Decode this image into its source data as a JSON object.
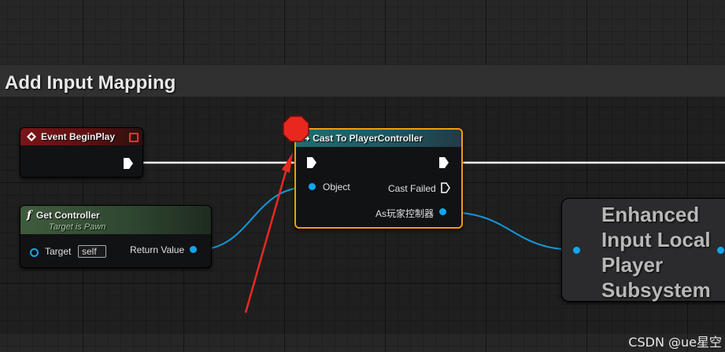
{
  "comment": {
    "title": "Add Input Mapping"
  },
  "event_begin_play": {
    "title": "Event BeginPlay"
  },
  "get_controller": {
    "title": "Get Controller",
    "subtitle": "Target is Pawn",
    "target_label": "Target",
    "target_value": "self",
    "return_label": "Return Value"
  },
  "cast_node": {
    "title": "Cast To PlayerController",
    "object_label": "Object",
    "cast_failed_label": "Cast Failed",
    "output_label": "As玩家控制器"
  },
  "subsystem_node": {
    "title": "Enhanced Input Local Player Subsystem"
  },
  "watermark": "CSDN @ue星空",
  "colors": {
    "exec_wire": "#ffffff",
    "data_wire": "#1596d6",
    "breakpoint": "#e8281e",
    "selection": "#f29d0c",
    "annotation_arrow": "#e82a22"
  },
  "icons": {
    "event": "event-diamond-icon",
    "function": "function-f-icon",
    "cast": "cast-arrow-icon",
    "breakpoint": "breakpoint-octagon-icon"
  }
}
